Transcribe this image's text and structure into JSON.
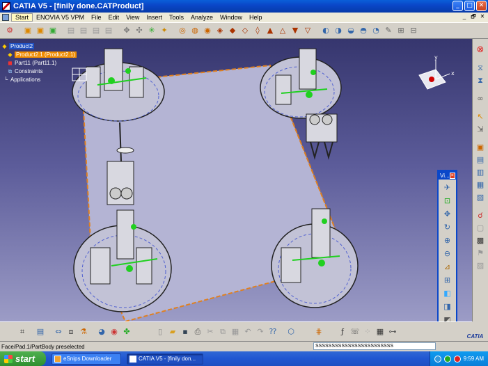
{
  "window": {
    "title": "CATIA V5 - [finily done.CATProduct]",
    "buttons": {
      "minimize": "_",
      "maximize": "□",
      "close": "✕"
    }
  },
  "menu": {
    "items": [
      "Start",
      "ENOVIA V5 VPM",
      "File",
      "Edit",
      "View",
      "Insert",
      "Tools",
      "Analyze",
      "Window",
      "Help"
    ],
    "mdi_buttons": {
      "minimize": "_",
      "restore": "🗗",
      "close": "✕"
    }
  },
  "tree": {
    "items": [
      {
        "label": "Product2",
        "state": "selected",
        "icon": "product-icon"
      },
      {
        "label": "Product2.1 (Product2.1)",
        "state": "highlighted",
        "icon": "product-icon"
      },
      {
        "label": "Part11 (Part11.1)",
        "state": "normal",
        "icon": "part-icon"
      },
      {
        "label": "Constraints",
        "state": "normal",
        "icon": "constraints-icon"
      },
      {
        "label": "Applications",
        "state": "normal",
        "icon": "applications-icon"
      }
    ]
  },
  "compass": {
    "x": "x",
    "y": "y"
  },
  "float_view": {
    "title": "Vi..."
  },
  "status": {
    "message": "Face/Pad.1/PartBody preselected",
    "command_value": "SSSSSSSSSSSSSSSSSSSSSSSS"
  },
  "logo": {
    "text": "CATIA"
  },
  "taskbar": {
    "start_label": "start",
    "tasks": [
      {
        "label": "eSnips Downloader",
        "active": false
      },
      {
        "label": "CATIA V5 - [finily don...",
        "active": true
      }
    ],
    "clock": "9:59 AM",
    "tray_icons": [
      "network-icon",
      "security-icon",
      "antivirus-icon"
    ]
  },
  "colors": {
    "titlebar": "#0a47c9",
    "viewport_top": "#36366e",
    "viewport_bottom": "#9c9cc6",
    "tree_selected": "#2050c0",
    "tree_highlight": "#f08c00",
    "part_outline": "#e08020",
    "geometry_accent": "#20d020",
    "taskbar": "#2157d1"
  }
}
